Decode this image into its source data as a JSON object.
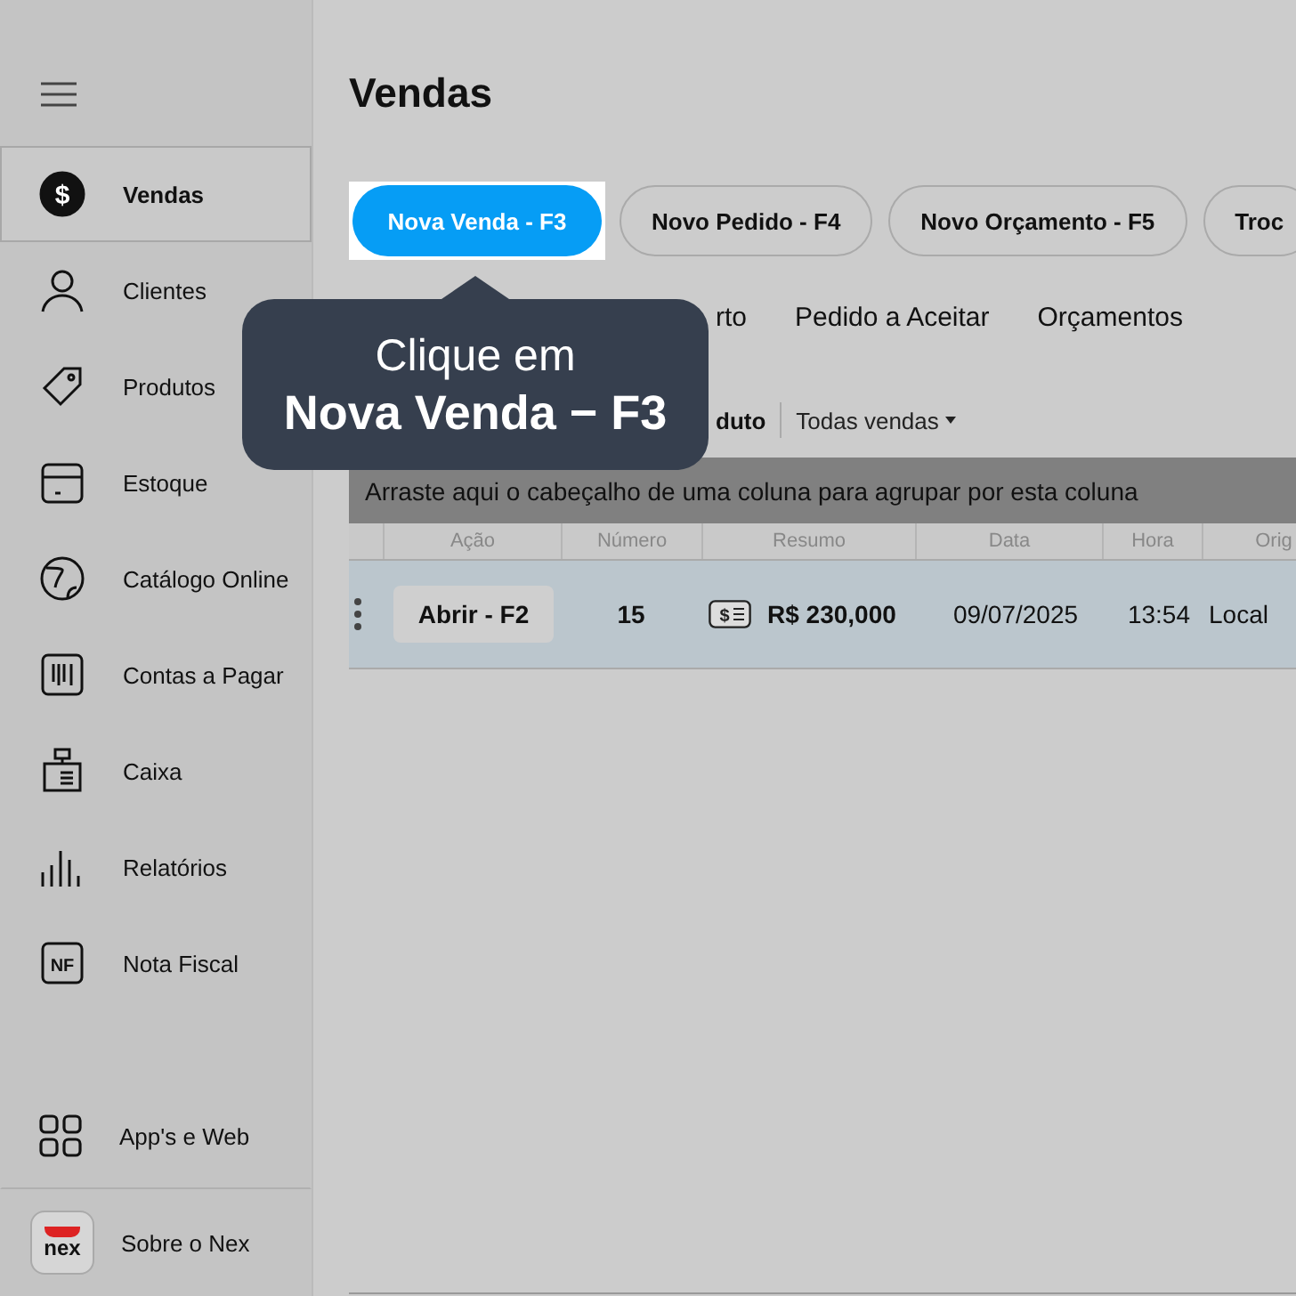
{
  "sidebar": {
    "items": [
      {
        "label": "Vendas",
        "selected": true,
        "icon_glyph": "$"
      },
      {
        "label": "Clientes",
        "selected": false
      },
      {
        "label": "Produtos",
        "selected": false
      },
      {
        "label": "Estoque",
        "selected": false
      },
      {
        "label": "Catálogo Online",
        "selected": false
      },
      {
        "label": "Contas a Pagar",
        "selected": false
      },
      {
        "label": "Caixa",
        "selected": false
      },
      {
        "label": "Relatórios",
        "selected": false
      },
      {
        "label": "Nota Fiscal",
        "selected": false,
        "icon_glyph": "NF"
      }
    ],
    "bottom_items": [
      {
        "label": "App's e Web"
      },
      {
        "label": "Sobre o Nex",
        "logo_text": "nex"
      }
    ]
  },
  "page": {
    "title": "Vendas",
    "actions": [
      {
        "label": "Nova Venda - F3",
        "kind": "primary",
        "highlighted": true
      },
      {
        "label": "Novo Pedido - F4",
        "kind": "outline",
        "highlighted": false
      },
      {
        "label": "Novo Orçamento - F5",
        "kind": "outline",
        "highlighted": false
      },
      {
        "label": "Troc",
        "kind": "outline",
        "highlighted": false
      }
    ],
    "tabs": [
      "rto",
      "Pedido a Aceitar",
      "Orçamentos"
    ],
    "filters": {
      "partial": "duto",
      "dropdown": "Todas vendas"
    },
    "group_hint": "Arraste aqui o cabeçalho de uma coluna para agrupar por esta coluna",
    "table": {
      "columns": [
        "Ação",
        "Número",
        "Resumo",
        "Data",
        "Hora",
        "Orig"
      ],
      "rows": [
        {
          "action": "Abrir - F2",
          "number": "15",
          "summary": "R$ 230,000",
          "summary_icon_glyph": "$",
          "date": "09/07/2025",
          "time": "13:54",
          "origin": "Local"
        }
      ]
    }
  },
  "tooltip": {
    "line_1": "Clique em",
    "line_2": "Nova Venda − F3"
  }
}
